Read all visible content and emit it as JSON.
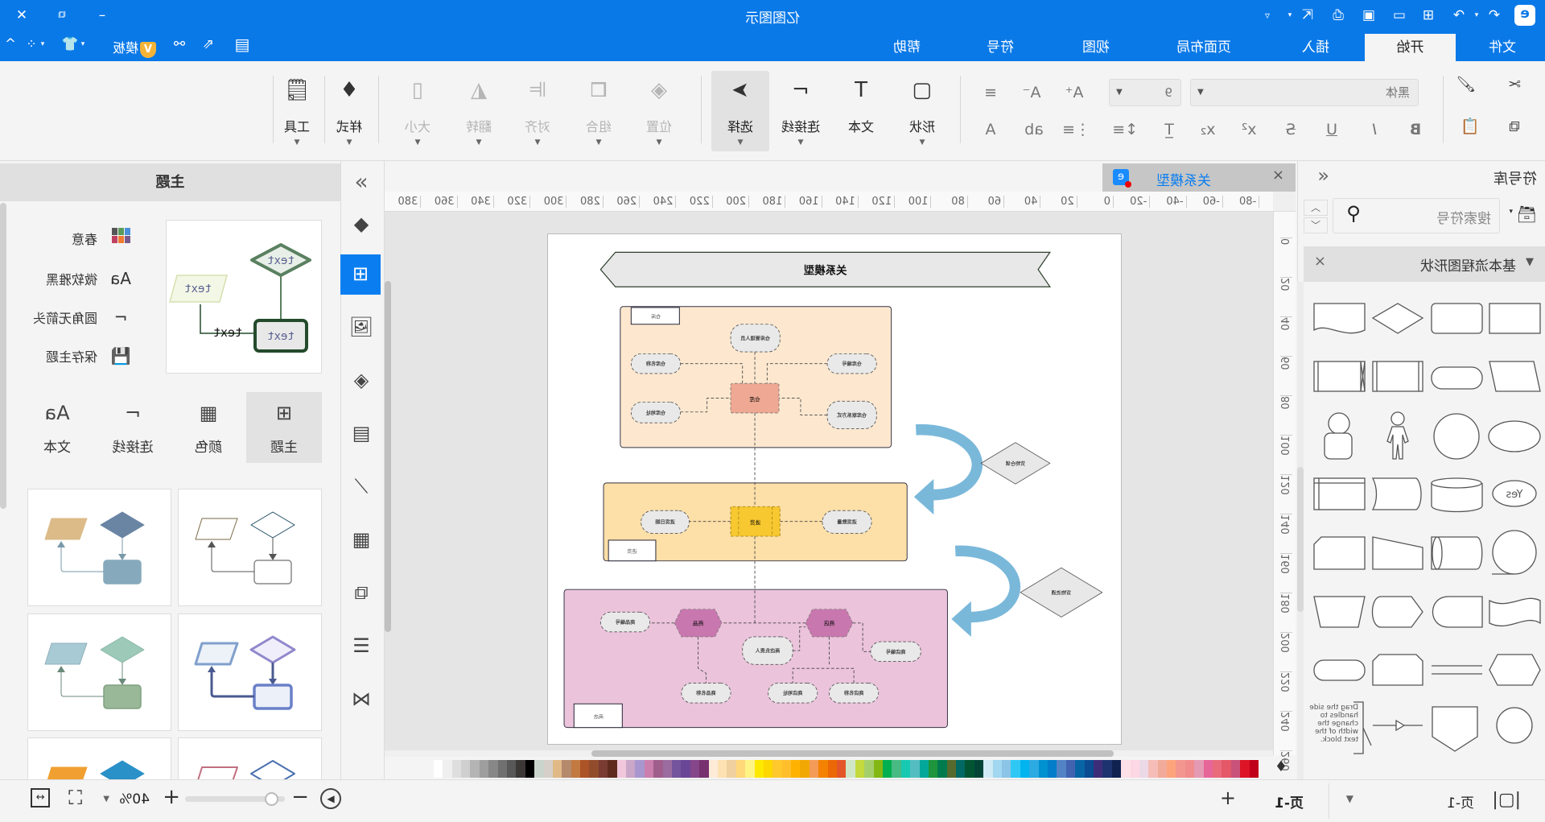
{
  "app": {
    "title": "亿图图示",
    "logo": "edraw-logo-icon",
    "accent": "#0a79e8"
  },
  "quick_access": [
    "undo-icon",
    "redo-icon",
    "new-icon",
    "open-icon",
    "save-icon",
    "print-icon",
    "export-icon",
    "customize-icon"
  ],
  "window_controls": [
    "minimize-icon",
    "restore-icon",
    "close-icon"
  ],
  "menu_tabs": [
    {
      "label": "文件"
    },
    {
      "label": "开始",
      "active": true
    },
    {
      "label": "插入"
    },
    {
      "label": "页面布局"
    },
    {
      "label": "视图"
    },
    {
      "label": "符号"
    },
    {
      "label": "帮助"
    }
  ],
  "tabs_right": {
    "member_label": "模板"
  },
  "ribbon": {
    "font_name": "黑体",
    "font_size": "9",
    "shape": "形状",
    "text": "文本",
    "connector": "连接线",
    "select": "选择",
    "position": "位置",
    "group": "组合",
    "align": "对齐",
    "flip": "翻转",
    "size": "大小",
    "style": "样式",
    "tools": "工具"
  },
  "symbol_library": {
    "title": "符号库",
    "search_placeholder": "搜索符号",
    "section": "基本流程图形状",
    "annotation_text": "Drag the side handles to change the width of the text block.",
    "yes_label": "Yes"
  },
  "document_tab": {
    "title": "关系模型"
  },
  "ruler": {
    "h": [
      -80,
      -60,
      -40,
      -20,
      0,
      20,
      40,
      60,
      80,
      100,
      120,
      140,
      160,
      180,
      200,
      220,
      240,
      260,
      280,
      300,
      320,
      340,
      360,
      380
    ],
    "v": [
      0,
      20,
      40,
      60,
      80,
      100,
      120,
      140,
      160,
      180,
      200,
      220,
      240,
      260
    ]
  },
  "diagram": {
    "title": "关系模型",
    "warehouse": {
      "label": "仓库",
      "center": "仓库",
      "manager": "仓库管理人员",
      "name": "仓库名称",
      "id": "仓库编号",
      "address": "仓库地址",
      "contact": "仓库联系方式"
    },
    "storage_relation": "货物仓储",
    "purchase": {
      "label": "进货",
      "center": "进货",
      "date": "进货日期",
      "qty": "进货数量"
    },
    "circulation_relation": "货物流通",
    "store": {
      "label": "商店",
      "goods": "商品",
      "shop": "商店",
      "goods_id": "商品编号",
      "manager": "商店负责人",
      "shop_id": "商店编号",
      "goods_name": "商品名称",
      "shop_address": "商店地址",
      "shop_name": "商店名称"
    },
    "colors": {
      "warehouse_bg": "#fde8cf",
      "warehouse_center": "#eea893",
      "purchase_bg": "#fddfa8",
      "purchase_center": "#f7c830",
      "store_bg": "#ebc3db",
      "hex": "#c878ae",
      "arrow": "#7ab8da"
    }
  },
  "theme_panel": {
    "title": "主题",
    "preview_text": "text",
    "items": [
      {
        "label": "春意",
        "icon": "color-grid-icon"
      },
      {
        "label": "微软雅黑",
        "icon": "font-icon"
      },
      {
        "label": "圆角无箭头",
        "icon": "connector-icon"
      },
      {
        "label": "保存主题",
        "icon": "save-icon"
      }
    ],
    "tabs": [
      {
        "label": "主题",
        "active": true
      },
      {
        "label": "颜色"
      },
      {
        "label": "连接线"
      },
      {
        "label": "文本"
      }
    ]
  },
  "palette": [
    "#ffffff",
    "#efefef",
    "#dedede",
    "#cfcfcf",
    "#b4b4b4",
    "#9e9e9e",
    "#878787",
    "#707070",
    "#585858",
    "#3d3838",
    "#000000",
    "#cbd4cc",
    "#d6cfc9",
    "#e0b987",
    "#b5896c",
    "#c27a40",
    "#ac5427",
    "#924c2c",
    "#7a3b32",
    "#5e2b1e",
    "#f0c7dc",
    "#caa6c8",
    "#a896cf",
    "#cb7fae",
    "#a05e8c",
    "#9a6ca0",
    "#74549c",
    "#6a4697",
    "#86468a",
    "#77316f",
    "#fdebd8",
    "#fde1b2",
    "#efd09e",
    "#fed879",
    "#fef385",
    "#fde900",
    "#fdd700",
    "#fdc92d",
    "#ffbe2c",
    "#ffb300",
    "#f2a804",
    "#f59b58",
    "#f48200",
    "#ec6705",
    "#e45627",
    "#d0e6c7",
    "#c3d93c",
    "#a5cf6b",
    "#83b812",
    "#00b050",
    "#48ba84",
    "#17c9b1",
    "#54bdc1",
    "#04a89a",
    "#1e943d",
    "#017a4d",
    "#566a2e",
    "#026863",
    "#015533",
    "#024537",
    "#cfeaf5",
    "#a1d7f0",
    "#8bc4e6",
    "#2fc8f5",
    "#00b4ef",
    "#2caae2",
    "#0091d1",
    "#037dc9",
    "#5183c5",
    "#4163b0",
    "#0864a5",
    "#0b4b91",
    "#3d2d79",
    "#1d336f",
    "#10224f",
    "#fde0e8",
    "#fdd7e4",
    "#ebd9e7",
    "#f6bdb8",
    "#f2ab9a",
    "#fea47c",
    "#f3968f",
    "#f08d8c",
    "#e49ab3",
    "#e6669a",
    "#e96a7b",
    "#e45868",
    "#c9527a",
    "#dc1426",
    "#c0001a"
  ],
  "status": {
    "page_tab": "页-1",
    "active_page": "页-1",
    "zoom": "40%",
    "zoom_percent": 40
  }
}
